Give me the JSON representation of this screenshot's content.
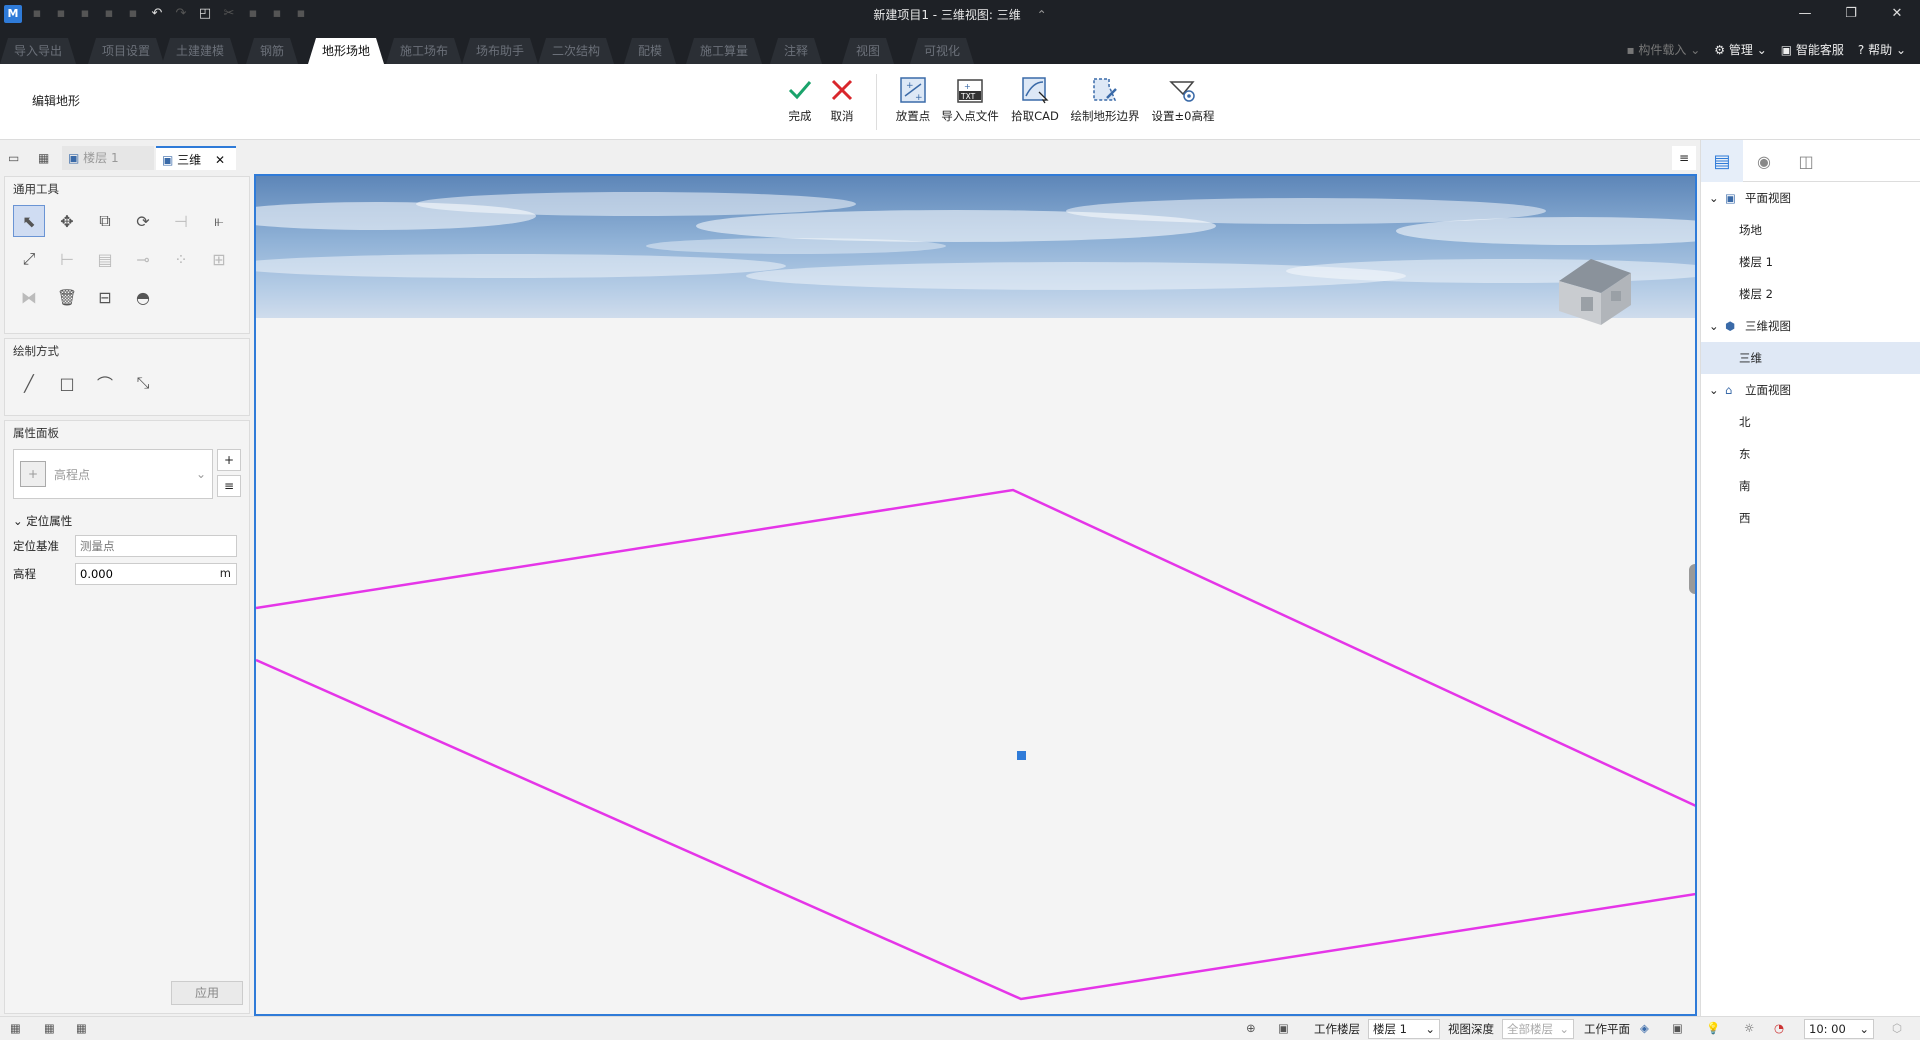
{
  "titlebar": {
    "title": "新建项目1 - 三维视图: 三维",
    "title_caret": "⌃",
    "minimize": "—",
    "restore": "❐",
    "close": "✕"
  },
  "ribbon_tabs": [
    {
      "label": "导入导出"
    },
    {
      "label": "项目设置"
    },
    {
      "label": "土建建模"
    },
    {
      "label": "钢筋"
    },
    {
      "label": "地形场地",
      "active": true
    },
    {
      "label": "施工场布"
    },
    {
      "label": "场布助手"
    },
    {
      "label": "二次结构"
    },
    {
      "label": "配模"
    },
    {
      "label": "施工算量"
    },
    {
      "label": "注释"
    },
    {
      "label": "视图"
    },
    {
      "label": "可视化"
    }
  ],
  "ribbon_right": {
    "component_load": "构件载入",
    "manage": "管理",
    "smart_service": "智能客服",
    "help": "帮助"
  },
  "ribbon": {
    "context_label": "编辑地形",
    "finish": "完成",
    "cancel": "取消",
    "place_point": "放置点",
    "import_points": "导入点文件",
    "pick_cad": "拾取CAD",
    "draw_boundary": "绘制地形边界",
    "set_zero_elev": "设置±0高程"
  },
  "view_tabs": {
    "floor1": "楼层 1",
    "three_d": "三维",
    "close": "✕"
  },
  "left_panel": {
    "general_tools": "通用工具",
    "draw_mode": "绘制方式",
    "properties": "属性面板",
    "type_select": "高程点",
    "position_props": "定位属性",
    "pos_base_label": "定位基准",
    "pos_base_placeholder": "测量点",
    "elevation_label": "高程",
    "elevation_value": "0.000",
    "elevation_unit": "m",
    "apply": "应用"
  },
  "tree": {
    "plan_views": "平面视图",
    "plan_items": [
      "场地",
      "楼层 1",
      "楼层 2"
    ],
    "three_d_views": "三维视图",
    "three_d_items": [
      "三维"
    ],
    "elevation_views": "立面视图",
    "elevation_items": [
      "北",
      "东",
      "南",
      "西"
    ]
  },
  "statusbar": {
    "work_floor_label": "工作楼层",
    "work_floor_value": "楼层 1",
    "view_depth_label": "视图深度",
    "view_depth_value": "全部楼层",
    "work_plane_label": "工作平面",
    "time_value": "10: 00"
  },
  "colors": {
    "accent": "#2f7bd8",
    "boundary": "#e535e8",
    "finish_green": "#1aa36b",
    "cancel_red": "#d9262c"
  }
}
